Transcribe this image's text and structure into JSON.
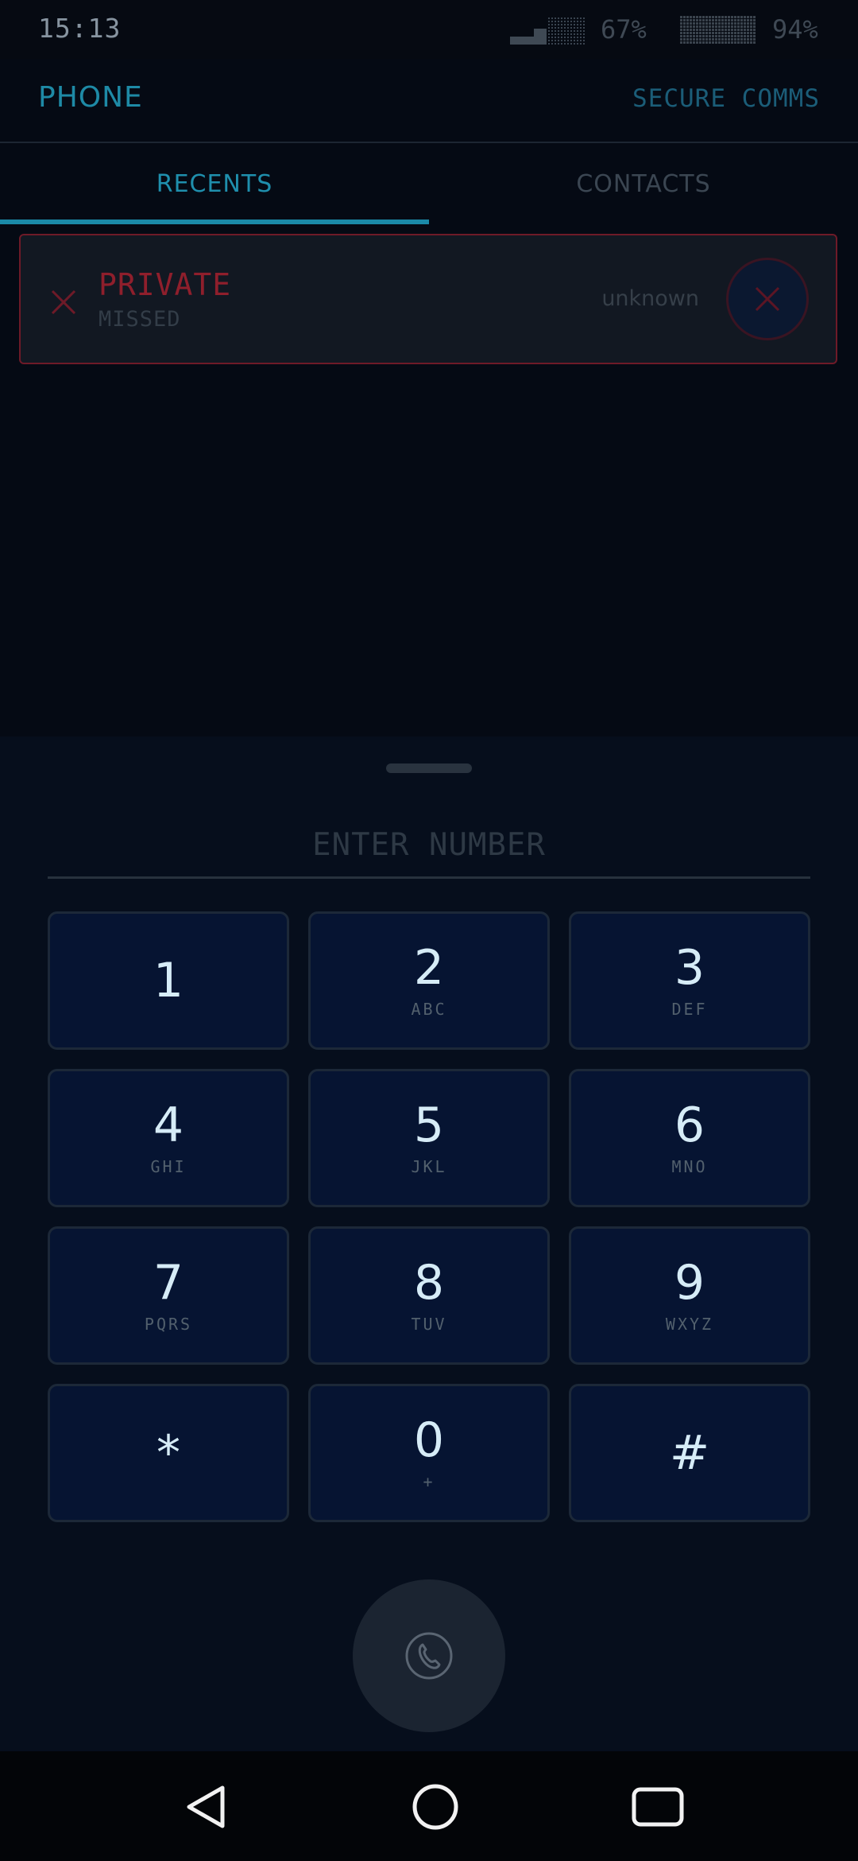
{
  "status_bar": {
    "time": "15:13",
    "signal_percent": "67%",
    "battery_percent": "94%",
    "signal_level": 0.67,
    "battery_level": 0.94,
    "signal_icon": "signal-bars-icon",
    "battery_icon": "battery-icon"
  },
  "header": {
    "title": "PHONE",
    "subtitle": "SECURE COMMS"
  },
  "tabs": [
    {
      "label": "RECENTS",
      "active": true
    },
    {
      "label": "CONTACTS",
      "active": false
    }
  ],
  "recents": [
    {
      "name": "PRIVATE",
      "status": "MISSED",
      "detail": "unknown",
      "status_icon": "missed-call-x-icon",
      "action_icon": "close-icon"
    }
  ],
  "dialer": {
    "placeholder": "ENTER NUMBER",
    "value": "",
    "keys": [
      {
        "digit": "1",
        "letters": ""
      },
      {
        "digit": "2",
        "letters": "ABC"
      },
      {
        "digit": "3",
        "letters": "DEF"
      },
      {
        "digit": "4",
        "letters": "GHI"
      },
      {
        "digit": "5",
        "letters": "JKL"
      },
      {
        "digit": "6",
        "letters": "MNO"
      },
      {
        "digit": "7",
        "letters": "PQRS"
      },
      {
        "digit": "8",
        "letters": "TUV"
      },
      {
        "digit": "9",
        "letters": "WXYZ"
      },
      {
        "digit": "*",
        "letters": ""
      },
      {
        "digit": "0",
        "letters": "+"
      },
      {
        "digit": "#",
        "letters": ""
      }
    ],
    "call_icon": "phone-handset-icon"
  },
  "nav": {
    "back_icon": "back-triangle-icon",
    "home_icon": "home-circle-icon",
    "recents_icon": "recents-square-icon"
  },
  "colors": {
    "accent": "#1f8fad",
    "missed": "#8f1f2c",
    "key_bg": "#061432",
    "background": "#050a14"
  }
}
